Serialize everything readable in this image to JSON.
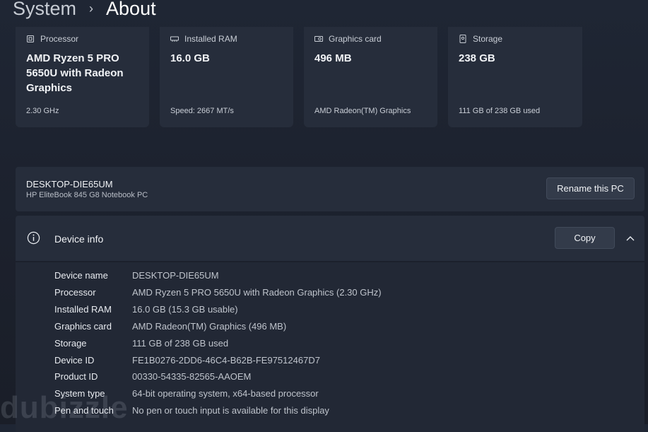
{
  "breadcrumb": {
    "parent": "System",
    "separator": "›",
    "current": "About"
  },
  "specs": [
    {
      "icon": "processor-icon",
      "label": "Processor",
      "value": "AMD Ryzen 5 PRO 5650U with Radeon Graphics",
      "sub": "2.30 GHz"
    },
    {
      "icon": "ram-icon",
      "label": "Installed RAM",
      "value": "16.0 GB",
      "sub": "Speed: 2667 MT/s"
    },
    {
      "icon": "graphics-card-icon",
      "label": "Graphics card",
      "value": "496 MB",
      "sub": "AMD Radeon(TM) Graphics"
    },
    {
      "icon": "storage-icon",
      "label": "Storage",
      "value": "238 GB",
      "sub": "111 GB of 238 GB used"
    }
  ],
  "pc": {
    "name": "DESKTOP-DIE65UM",
    "model": "HP EliteBook 845 G8 Notebook PC",
    "rename_label": "Rename this PC"
  },
  "device_info": {
    "title": "Device info",
    "copy_label": "Copy",
    "rows": [
      {
        "key": "Device name",
        "value": "DESKTOP-DIE65UM"
      },
      {
        "key": "Processor",
        "value": "AMD Ryzen 5 PRO 5650U with Radeon Graphics (2.30 GHz)"
      },
      {
        "key": "Installed RAM",
        "value": "16.0 GB (15.3 GB usable)"
      },
      {
        "key": "Graphics card",
        "value": "AMD Radeon(TM) Graphics (496 MB)"
      },
      {
        "key": "Storage",
        "value": "111 GB of 238 GB used"
      },
      {
        "key": "Device ID",
        "value": "FE1B0276-2DD6-46C4-B62B-FE97512467D7"
      },
      {
        "key": "Product ID",
        "value": "00330-54335-82565-AAOEM"
      },
      {
        "key": "System type",
        "value": "64-bit operating system, x64-based processor"
      },
      {
        "key": "Pen and touch",
        "value": "No pen or touch input is available for this display"
      }
    ]
  },
  "watermark": "dubizzle"
}
